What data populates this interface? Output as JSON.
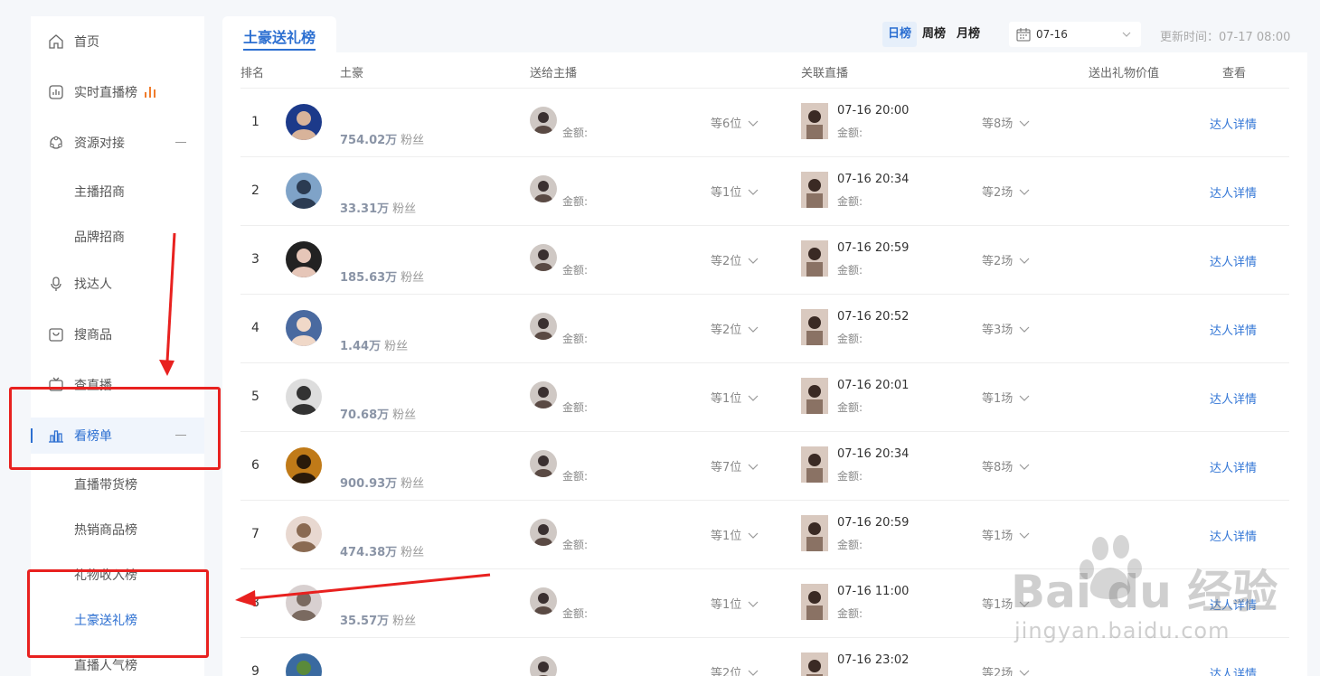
{
  "sidebar": {
    "items": [
      {
        "label": "首页",
        "icon": "home-icon"
      },
      {
        "label": "实时直播榜",
        "icon": "chart-box-icon"
      },
      {
        "label": "资源对接",
        "icon": "network-icon"
      },
      {
        "label": "主播招商"
      },
      {
        "label": "品牌招商"
      },
      {
        "label": "找达人",
        "icon": "mic-icon"
      },
      {
        "label": "搜商品",
        "icon": "bag-icon"
      },
      {
        "label": "查直播",
        "icon": "tv-icon"
      },
      {
        "label": "看榜单",
        "icon": "bar-chart-icon"
      },
      {
        "label": "直播带货榜"
      },
      {
        "label": "热销商品榜"
      },
      {
        "label": "礼物收入榜"
      },
      {
        "label": "土豪送礼榜"
      },
      {
        "label": "直播人气榜"
      }
    ]
  },
  "header": {
    "tab": "土豪送礼榜",
    "periods": [
      "日榜",
      "周榜",
      "月榜"
    ],
    "active_period": "日榜",
    "date": "07-16",
    "update_time": "更新时间：07-17 08:00"
  },
  "columns": [
    "排名",
    "土豪",
    "送给主播",
    "关联直播",
    "送出礼物价值",
    "查看"
  ],
  "rows": [
    {
      "rank": "1",
      "fans_num": "754.02万",
      "fans_unit": "粉丝",
      "amount": "金额:",
      "hosts": "等6位",
      "live_time": "07-16 20:00",
      "live_amount": "金额:",
      "lives": "等8场",
      "detail": "达人详情"
    },
    {
      "rank": "2",
      "fans_num": "33.31万",
      "fans_unit": "粉丝",
      "amount": "金额:",
      "hosts": "等1位",
      "live_time": "07-16 20:34",
      "live_amount": "金额:",
      "lives": "等2场",
      "detail": "达人详情"
    },
    {
      "rank": "3",
      "fans_num": "185.63万",
      "fans_unit": "粉丝",
      "amount": "金额:",
      "hosts": "等2位",
      "live_time": "07-16 20:59",
      "live_amount": "金额:",
      "lives": "等2场",
      "detail": "达人详情"
    },
    {
      "rank": "4",
      "fans_num": "1.44万",
      "fans_unit": "粉丝",
      "amount": "金额:",
      "hosts": "等2位",
      "live_time": "07-16 20:52",
      "live_amount": "金额:",
      "lives": "等3场",
      "detail": "达人详情"
    },
    {
      "rank": "5",
      "fans_num": "70.68万",
      "fans_unit": "粉丝",
      "amount": "金额:",
      "hosts": "等1位",
      "live_time": "07-16 20:01",
      "live_amount": "金额:",
      "lives": "等1场",
      "detail": "达人详情"
    },
    {
      "rank": "6",
      "fans_num": "900.93万",
      "fans_unit": "粉丝",
      "amount": "金额:",
      "hosts": "等7位",
      "live_time": "07-16 20:34",
      "live_amount": "金额:",
      "lives": "等8场",
      "detail": "达人详情"
    },
    {
      "rank": "7",
      "fans_num": "474.38万",
      "fans_unit": "粉丝",
      "amount": "金额:",
      "hosts": "等1位",
      "live_time": "07-16 20:59",
      "live_amount": "金额:",
      "lives": "等1场",
      "detail": "达人详情"
    },
    {
      "rank": "8",
      "fans_num": "35.57万",
      "fans_unit": "粉丝",
      "amount": "金额:",
      "hosts": "等1位",
      "live_time": "07-16 11:00",
      "live_amount": "金额:",
      "lives": "等1场",
      "detail": "达人详情"
    },
    {
      "rank": "9",
      "fans_num": "",
      "fans_unit": "",
      "amount": "",
      "hosts": "等2位",
      "live_time": "07-16 23:02",
      "live_amount": "",
      "lives": "等2场",
      "detail": "达人详情"
    }
  ],
  "colors": {
    "accent": "#2c6fd1",
    "annotation": "#e8211f",
    "link": "#3477d6"
  },
  "watermark": {
    "brand": "Bai du 经验",
    "url": "jingyan.baidu.com"
  }
}
